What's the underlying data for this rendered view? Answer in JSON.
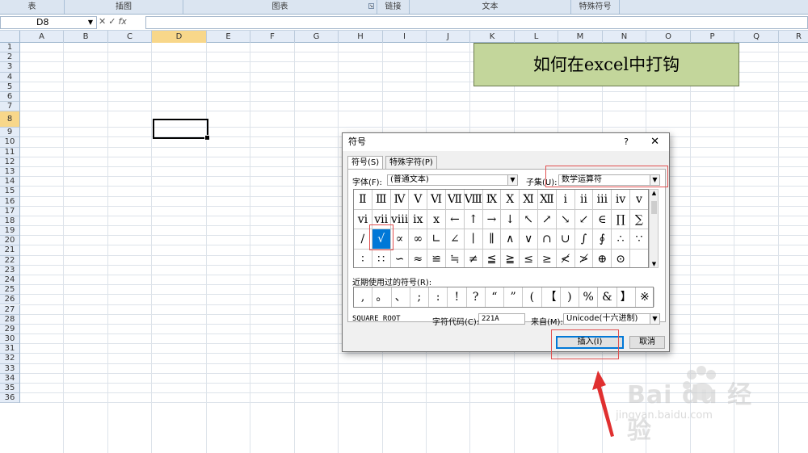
{
  "ribbon": {
    "groups": [
      "表",
      "插图",
      "图表",
      "链接",
      "文本",
      "特殊符号"
    ]
  },
  "formula_bar": {
    "name_box": "D8",
    "fx_label": "fx",
    "formula": ""
  },
  "sheet": {
    "columns": [
      "A",
      "B",
      "C",
      "D",
      "E",
      "F",
      "G",
      "H",
      "I",
      "J",
      "K",
      "L",
      "M",
      "N",
      "O",
      "P",
      "Q",
      "R"
    ],
    "selected_column": "D",
    "rows": [
      "1",
      "2",
      "3",
      "4",
      "5",
      "6",
      "7",
      "8",
      "9",
      "10",
      "11",
      "12",
      "13",
      "14",
      "15",
      "16",
      "17",
      "18",
      "19",
      "20",
      "21",
      "22",
      "23",
      "24",
      "25",
      "26",
      "27",
      "28",
      "29",
      "30",
      "31",
      "32",
      "33",
      "34",
      "35",
      "36"
    ],
    "selected_row": "8",
    "title_cell_text": "如何在excel中打钩",
    "title_cell_color": "#c3d69b"
  },
  "dialog": {
    "title": "符号",
    "help": "?",
    "close": "✕",
    "tabs": [
      "符号(S)",
      "特殊字符(P)"
    ],
    "font_label": "字体(F):",
    "font_value": "(普通文本)",
    "subset_label": "子集(U):",
    "subset_value": "数学运算符",
    "symbols": [
      [
        "Ⅱ",
        "Ⅲ",
        "Ⅳ",
        "Ⅴ",
        "Ⅵ",
        "Ⅶ",
        "Ⅷ",
        "Ⅸ",
        "Ⅹ",
        "Ⅺ",
        "Ⅻ",
        "ⅰ",
        "ⅱ",
        "ⅲ",
        "ⅳ",
        "ⅴ"
      ],
      [
        "ⅵ",
        "ⅶ",
        "ⅷ",
        "ⅸ",
        "ⅹ",
        "←",
        "↑",
        "→",
        "↓",
        "↖",
        "↗",
        "↘",
        "↙",
        "∈",
        "∏",
        "∑"
      ],
      [
        "∕",
        "√",
        "∝",
        "∞",
        "∟",
        "∠",
        "∣",
        "∥",
        "∧",
        "∨",
        "∩",
        "∪",
        "∫",
        "∮",
        "∴",
        "∵"
      ],
      [
        "∶",
        "∷",
        "∽",
        "≈",
        "≌",
        "≒",
        "≠",
        "≦",
        "≧",
        "≤",
        "≥",
        "≮",
        "≯",
        "⊕",
        "⊙",
        ""
      ]
    ],
    "selected_symbol": "√",
    "recent_label": "近期使用过的符号(R):",
    "recent_symbols": [
      ",",
      "。",
      "、",
      ";",
      ":",
      "!",
      "?",
      "“",
      "”",
      "(",
      "【",
      ")",
      "%",
      "&",
      "】",
      "※"
    ],
    "char_name": "SQUARE ROOT",
    "char_code_label": "字符代码(C):",
    "char_code_value": "221A",
    "from_label": "来自(M):",
    "from_value": "Unicode(十六进制)",
    "insert_label": "插入(I)",
    "cancel_label": "取消"
  },
  "watermark": {
    "brand": "Bai du 经验",
    "url": "jingyan.baidu.com"
  },
  "colors": {
    "selection": "#0078d7",
    "highlight_box": "#e05050",
    "arrow": "#e03030"
  }
}
